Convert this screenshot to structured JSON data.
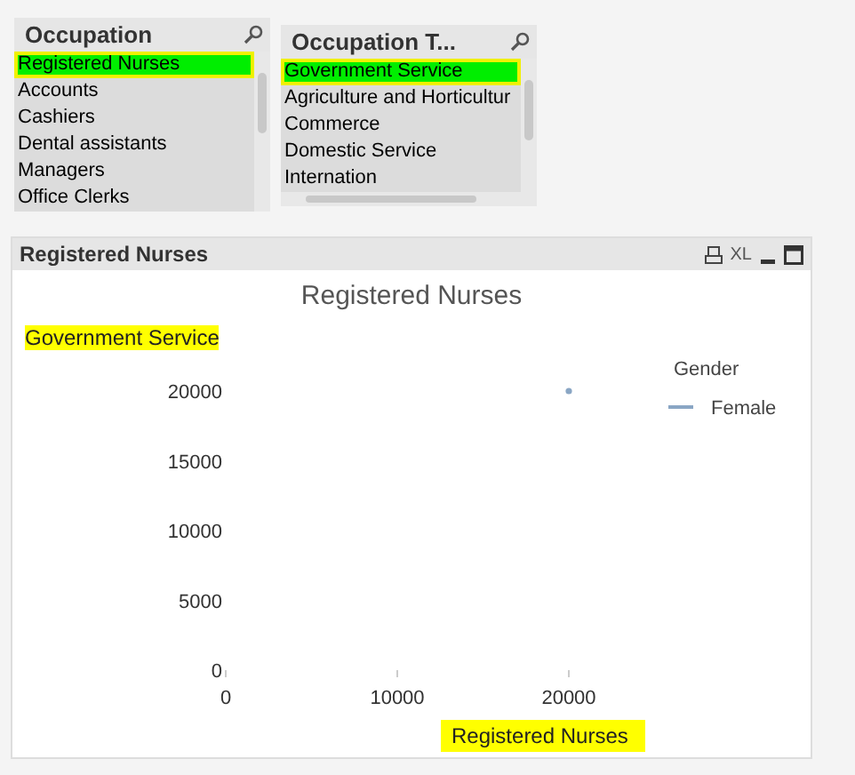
{
  "listboxes": [
    {
      "title": "Occupation",
      "items": [
        {
          "label": "Registered Nurses",
          "selected": true,
          "highlighted": true
        },
        {
          "label": "Accounts",
          "selected": false,
          "highlighted": false
        },
        {
          "label": "Cashiers",
          "selected": false,
          "highlighted": false
        },
        {
          "label": "Dental assistants",
          "selected": false,
          "highlighted": false
        },
        {
          "label": "Managers",
          "selected": false,
          "highlighted": false
        },
        {
          "label": "Office Clerks",
          "selected": false,
          "highlighted": false
        }
      ]
    },
    {
      "title": "Occupation T...",
      "items": [
        {
          "label": "Government Service",
          "selected": true,
          "highlighted": true
        },
        {
          "label": "Agriculture and Horticultur",
          "selected": false,
          "highlighted": false
        },
        {
          "label": "Commerce",
          "selected": false,
          "highlighted": false
        },
        {
          "label": "Domestic Service",
          "selected": false,
          "highlighted": false
        },
        {
          "label": "Internation",
          "selected": false,
          "highlighted": false
        }
      ]
    }
  ],
  "chart_panel": {
    "caption": "Registered Nurses",
    "caption_buttons": [
      {
        "kind": "print"
      },
      {
        "kind": "xl",
        "label": "XL"
      },
      {
        "kind": "minimize"
      },
      {
        "kind": "maximize"
      }
    ],
    "subtitle": {
      "text": "Government Service",
      "highlighted": true
    },
    "chart_data": {
      "type": "scatter",
      "title": "Registered Nurses",
      "xlabel": "Registered Nurses",
      "x": [
        20000
      ],
      "series": [
        {
          "name": "Female",
          "color": "#8aa6c4",
          "values": [
            20000
          ]
        }
      ],
      "xlim": [
        0,
        20000
      ],
      "ylim": [
        0,
        20000
      ],
      "xticks": [
        0,
        10000,
        20000
      ],
      "yticks": [
        0,
        5000,
        10000,
        15000,
        20000
      ],
      "legend_title": "Gender"
    },
    "xlabel_highlighted": true
  }
}
